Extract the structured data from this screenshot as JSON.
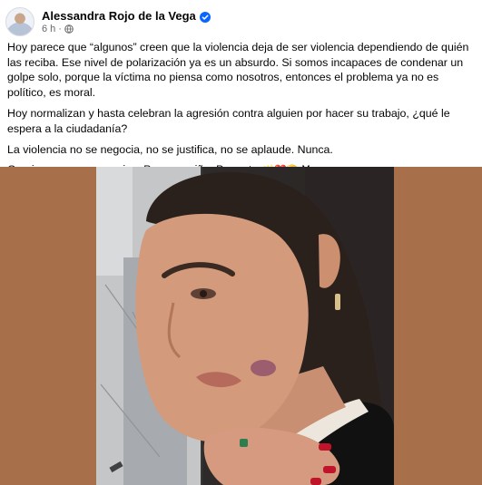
{
  "post": {
    "author": "Alessandra Rojo de la Vega",
    "verified_icon": "verified-badge-icon",
    "timestamp": "6 h",
    "separator": "·",
    "privacy_icon": "globe-icon",
    "paragraphs": [
      "Hoy parece que “algunos” creen que la violencia deja de ser violencia dependiendo de quién las reciba. Ese nivel de polarización ya es un absurdo. Si somos incapaces de condenar un golpe solo, porque la víctima no piensa como nosotros, entonces el problema ya no es político, es moral.",
      "Hoy normalizan y hasta celebran la agresión contra alguien por hacer su trabajo, ¿qué le espera a la ciudadanía?",
      "La violencia no se negocia, no se justifica, no se aplaude. Nunca."
    ],
    "last_line": "Gracias por sus mensajes. Por su cariño. Por estar",
    "last_line_emojis": "🪄❤️🫡",
    "see_less": "Ver menos",
    "photo_alt": "Woman with a bruise on her cheek",
    "colors": {
      "frame_background": "#a8704a",
      "verified": "#0866ff",
      "secondary_text": "#65676b"
    }
  }
}
